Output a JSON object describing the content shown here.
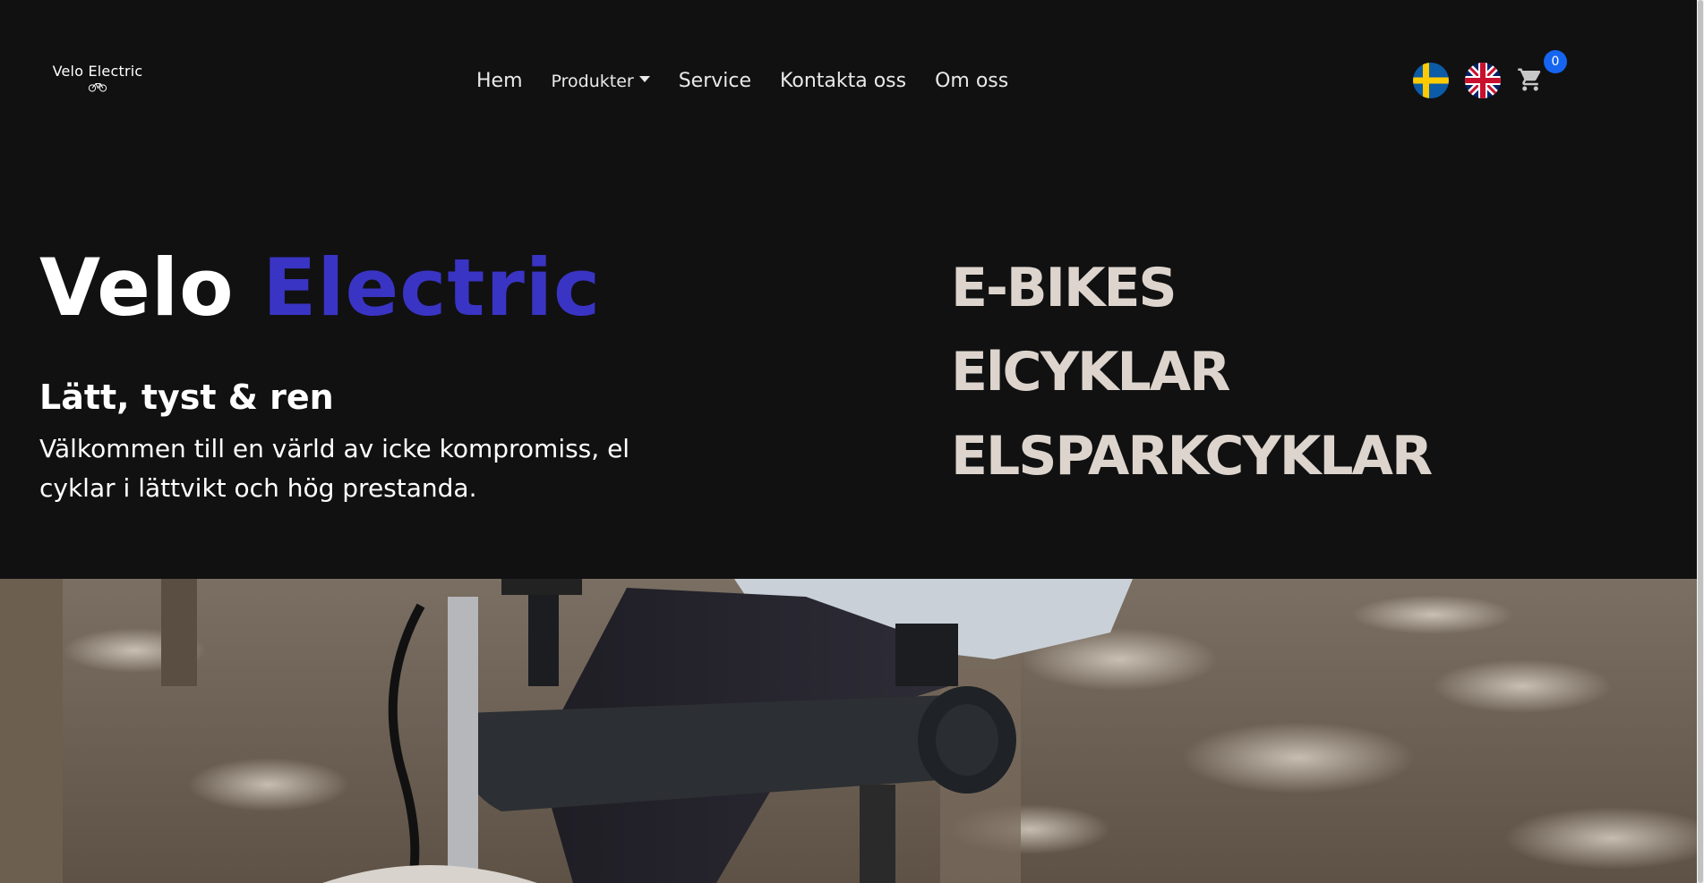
{
  "nav": {
    "logo_text": "Velo Electric",
    "menu": [
      {
        "label": "Hem"
      },
      {
        "label": "Produkter",
        "has_dropdown": true
      },
      {
        "label": "Service"
      },
      {
        "label": "Kontakta oss"
      },
      {
        "label": "Om oss"
      }
    ],
    "languages": [
      {
        "name": "Svenska",
        "icon": "swedish-flag-icon"
      },
      {
        "name": "English",
        "icon": "uk-flag-icon"
      }
    ],
    "cart": {
      "icon": "cart-icon",
      "count": "0"
    }
  },
  "hero": {
    "title_part1": "Velo",
    "title_part2": "Electric",
    "tagline": "Lätt, tyst & ren",
    "description": "Välkommen till en värld av icke kompromiss, el cyklar i lättvikt och hög prestanda.",
    "categories": [
      "E-BIKES",
      "ElCYKLAR",
      "ELSPARKCYKLAR"
    ]
  },
  "colors": {
    "background": "#111112",
    "accent": "#3a34c4",
    "category_text": "#ddd5cd",
    "cart_badge": "#1565f0"
  }
}
